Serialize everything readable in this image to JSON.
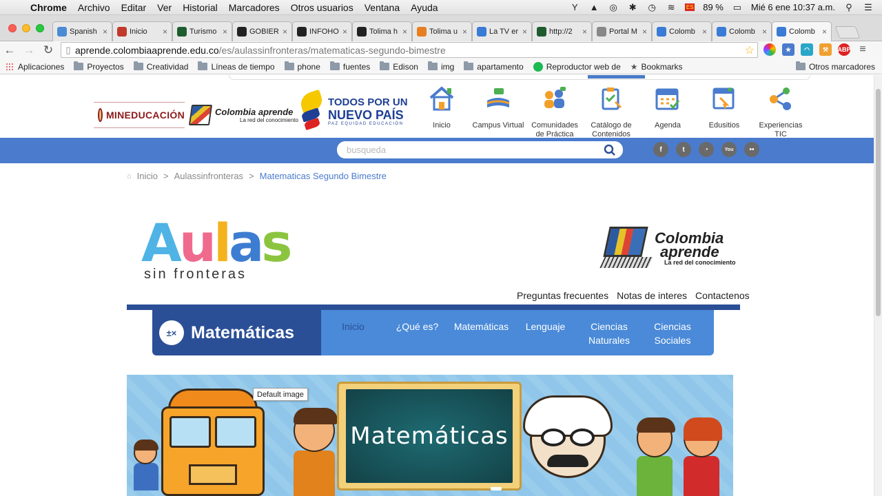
{
  "menubar": {
    "app": "Chrome",
    "items": [
      "Archivo",
      "Editar",
      "Ver",
      "Historial",
      "Marcadores",
      "Otros usuarios",
      "Ventana",
      "Ayuda"
    ],
    "battery": "89 %",
    "datetime": "Mié 6 ene  10:37 a.m."
  },
  "tabs": [
    {
      "label": "Spanish",
      "favicon_color": "#4a8bd4"
    },
    {
      "label": "Inicio",
      "favicon_color": "#c0392b"
    },
    {
      "label": "Turismo",
      "favicon_color": "#1e5c2e"
    },
    {
      "label": "GOBIER",
      "favicon_color": "#222222"
    },
    {
      "label": "INFOHO",
      "favicon_color": "#222222"
    },
    {
      "label": "Tolima h",
      "favicon_color": "#222222"
    },
    {
      "label": "Tolima u",
      "favicon_color": "#e67e22"
    },
    {
      "label": "La TV er",
      "favicon_color": "#3a7bd5"
    },
    {
      "label": "http://2",
      "favicon_color": "#1e5c2e"
    },
    {
      "label": "Portal M",
      "favicon_color": "#888888"
    },
    {
      "label": "Colomb",
      "favicon_color": "#3a7bd5"
    },
    {
      "label": "Colomb",
      "favicon_color": "#3a7bd5"
    },
    {
      "label": "Colomb",
      "favicon_color": "#3a7bd5",
      "active": true
    }
  ],
  "address": {
    "host": "aprende.colombiaaprende.edu.co",
    "path": "/es/aulassinfronteras/matematicas-segundo-bimestre"
  },
  "extensions": [
    "pinwheel-icon",
    "bookmark-star-icon",
    "wave-icon",
    "tools-icon",
    "adblock-icon",
    "menu-icon"
  ],
  "bookmarks": {
    "apps": "Aplicaciones",
    "items": [
      "Proyectos",
      "Creatividad",
      "Líneas de tiempo",
      "phone",
      "fuentes",
      "Edison",
      "img",
      "apartamento",
      "Reproductor web de",
      "Bookmarks"
    ],
    "other": "Otros marcadores"
  },
  "site": {
    "ministry": "MINEDUCACIÓN",
    "ca_name": "Colombia aprende",
    "ca_sub": "La red del conocimiento",
    "tpun_l1": "TODOS POR UN",
    "tpun_l2": "NUEVO PAÍS",
    "tpun_l3": "PAZ  EQUIDAD  EDUCACIÓN",
    "nav": [
      {
        "label": "Inicio",
        "icon": "house-icon"
      },
      {
        "label": "Campus Virtual",
        "icon": "open-book-icon"
      },
      {
        "label": "Comunidades de Práctica",
        "icon": "people-icon"
      },
      {
        "label": "Catálogo de Contenidos",
        "icon": "clipboard-icon"
      },
      {
        "label": "Agenda",
        "icon": "calendar-icon"
      },
      {
        "label": "Edusitios",
        "icon": "browser-window-icon"
      },
      {
        "label": "Experiencias TIC",
        "icon": "share-nodes-icon"
      }
    ],
    "search_placeholder": "busqueda",
    "social": [
      "f",
      "t",
      "rss",
      "You Tube",
      "flickr"
    ]
  },
  "breadcrumb": {
    "home": "Inicio",
    "section": "Aulassinfronteras",
    "current": "Matematicas Segundo Bimestre"
  },
  "aulas": {
    "letters": [
      {
        "ch": "A",
        "color": "#4fb3e6"
      },
      {
        "ch": "u",
        "color": "#f06a8d"
      },
      {
        "ch": "l",
        "color": "#f4b21c"
      },
      {
        "ch": "a",
        "color": "#3d7dd1"
      },
      {
        "ch": "s",
        "color": "#8bc53f"
      }
    ],
    "sub": "sin fronteras"
  },
  "ca_big": {
    "name_l1": "Colombia",
    "name_l2": "aprende",
    "sub": "La red del conocimiento"
  },
  "info_links": [
    "Preguntas frecuentes",
    "Notas de interes",
    "Contactenos"
  ],
  "subject": {
    "icon_text": "±×",
    "name": "Matemáticas",
    "menu": [
      "Inicio",
      "¿Qué es?",
      "Matemáticas",
      "Lenguaje",
      "Ciencias Naturales",
      "Ciencias Sociales"
    ]
  },
  "banner": {
    "board_text": "Matemáticas",
    "tooltip": "Default image"
  }
}
